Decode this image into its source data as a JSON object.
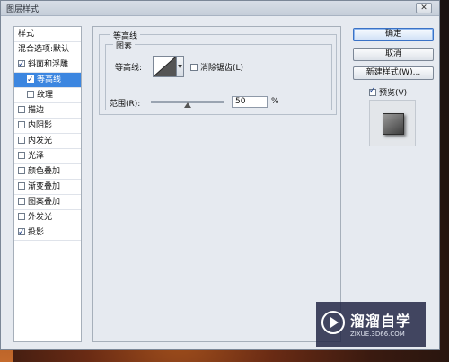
{
  "window": {
    "title": "图层样式"
  },
  "sidebar": {
    "header": "样式",
    "blend_options": "混合选项:默认",
    "items": [
      {
        "label": "斜面和浮雕",
        "checked": true,
        "selected": false,
        "sub": false
      },
      {
        "label": "等高线",
        "checked": true,
        "selected": true,
        "sub": true
      },
      {
        "label": "纹理",
        "checked": false,
        "selected": false,
        "sub": true
      },
      {
        "label": "描边",
        "checked": false,
        "selected": false,
        "sub": false
      },
      {
        "label": "内阴影",
        "checked": false,
        "selected": false,
        "sub": false
      },
      {
        "label": "内发光",
        "checked": false,
        "selected": false,
        "sub": false
      },
      {
        "label": "光泽",
        "checked": false,
        "selected": false,
        "sub": false
      },
      {
        "label": "颜色叠加",
        "checked": false,
        "selected": false,
        "sub": false
      },
      {
        "label": "渐变叠加",
        "checked": false,
        "selected": false,
        "sub": false
      },
      {
        "label": "图案叠加",
        "checked": false,
        "selected": false,
        "sub": false
      },
      {
        "label": "外发光",
        "checked": false,
        "selected": false,
        "sub": false
      },
      {
        "label": "投影",
        "checked": true,
        "selected": false,
        "sub": false
      }
    ]
  },
  "panel": {
    "group_title": "等高线",
    "subgroup_title": "图素",
    "contour_label": "等高线:",
    "antialias_label": "消除锯齿(L)",
    "antialias_checked": false,
    "range_label": "范围(R):",
    "range_value": "50",
    "range_unit": "%",
    "range_fraction": 0.5
  },
  "buttons": {
    "ok": "确定",
    "cancel": "取消",
    "new_style": "新建样式(W)..."
  },
  "preview": {
    "label": "预览(V)",
    "checked": true
  },
  "watermark": {
    "brand": "溜溜自学",
    "url": "ZIXUE.3D66.COM"
  }
}
